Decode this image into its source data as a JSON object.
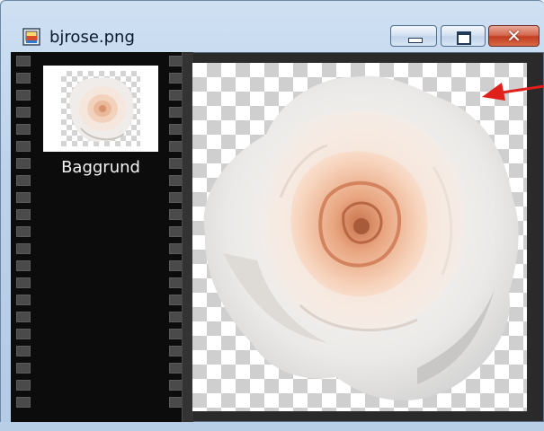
{
  "window": {
    "title": "bjrose.png",
    "minimize_label": "",
    "maximize_label": "",
    "close_label": "✕"
  },
  "layers": [
    {
      "label": "Baggrund",
      "selected": true
    }
  ],
  "colors": {
    "filmstrip_bg": "#0c0c0c",
    "arrow": "#e0201a",
    "close_button": "#c9482d"
  },
  "icons": {
    "app": "image-file-icon",
    "annotation": "red-arrow-icon"
  }
}
